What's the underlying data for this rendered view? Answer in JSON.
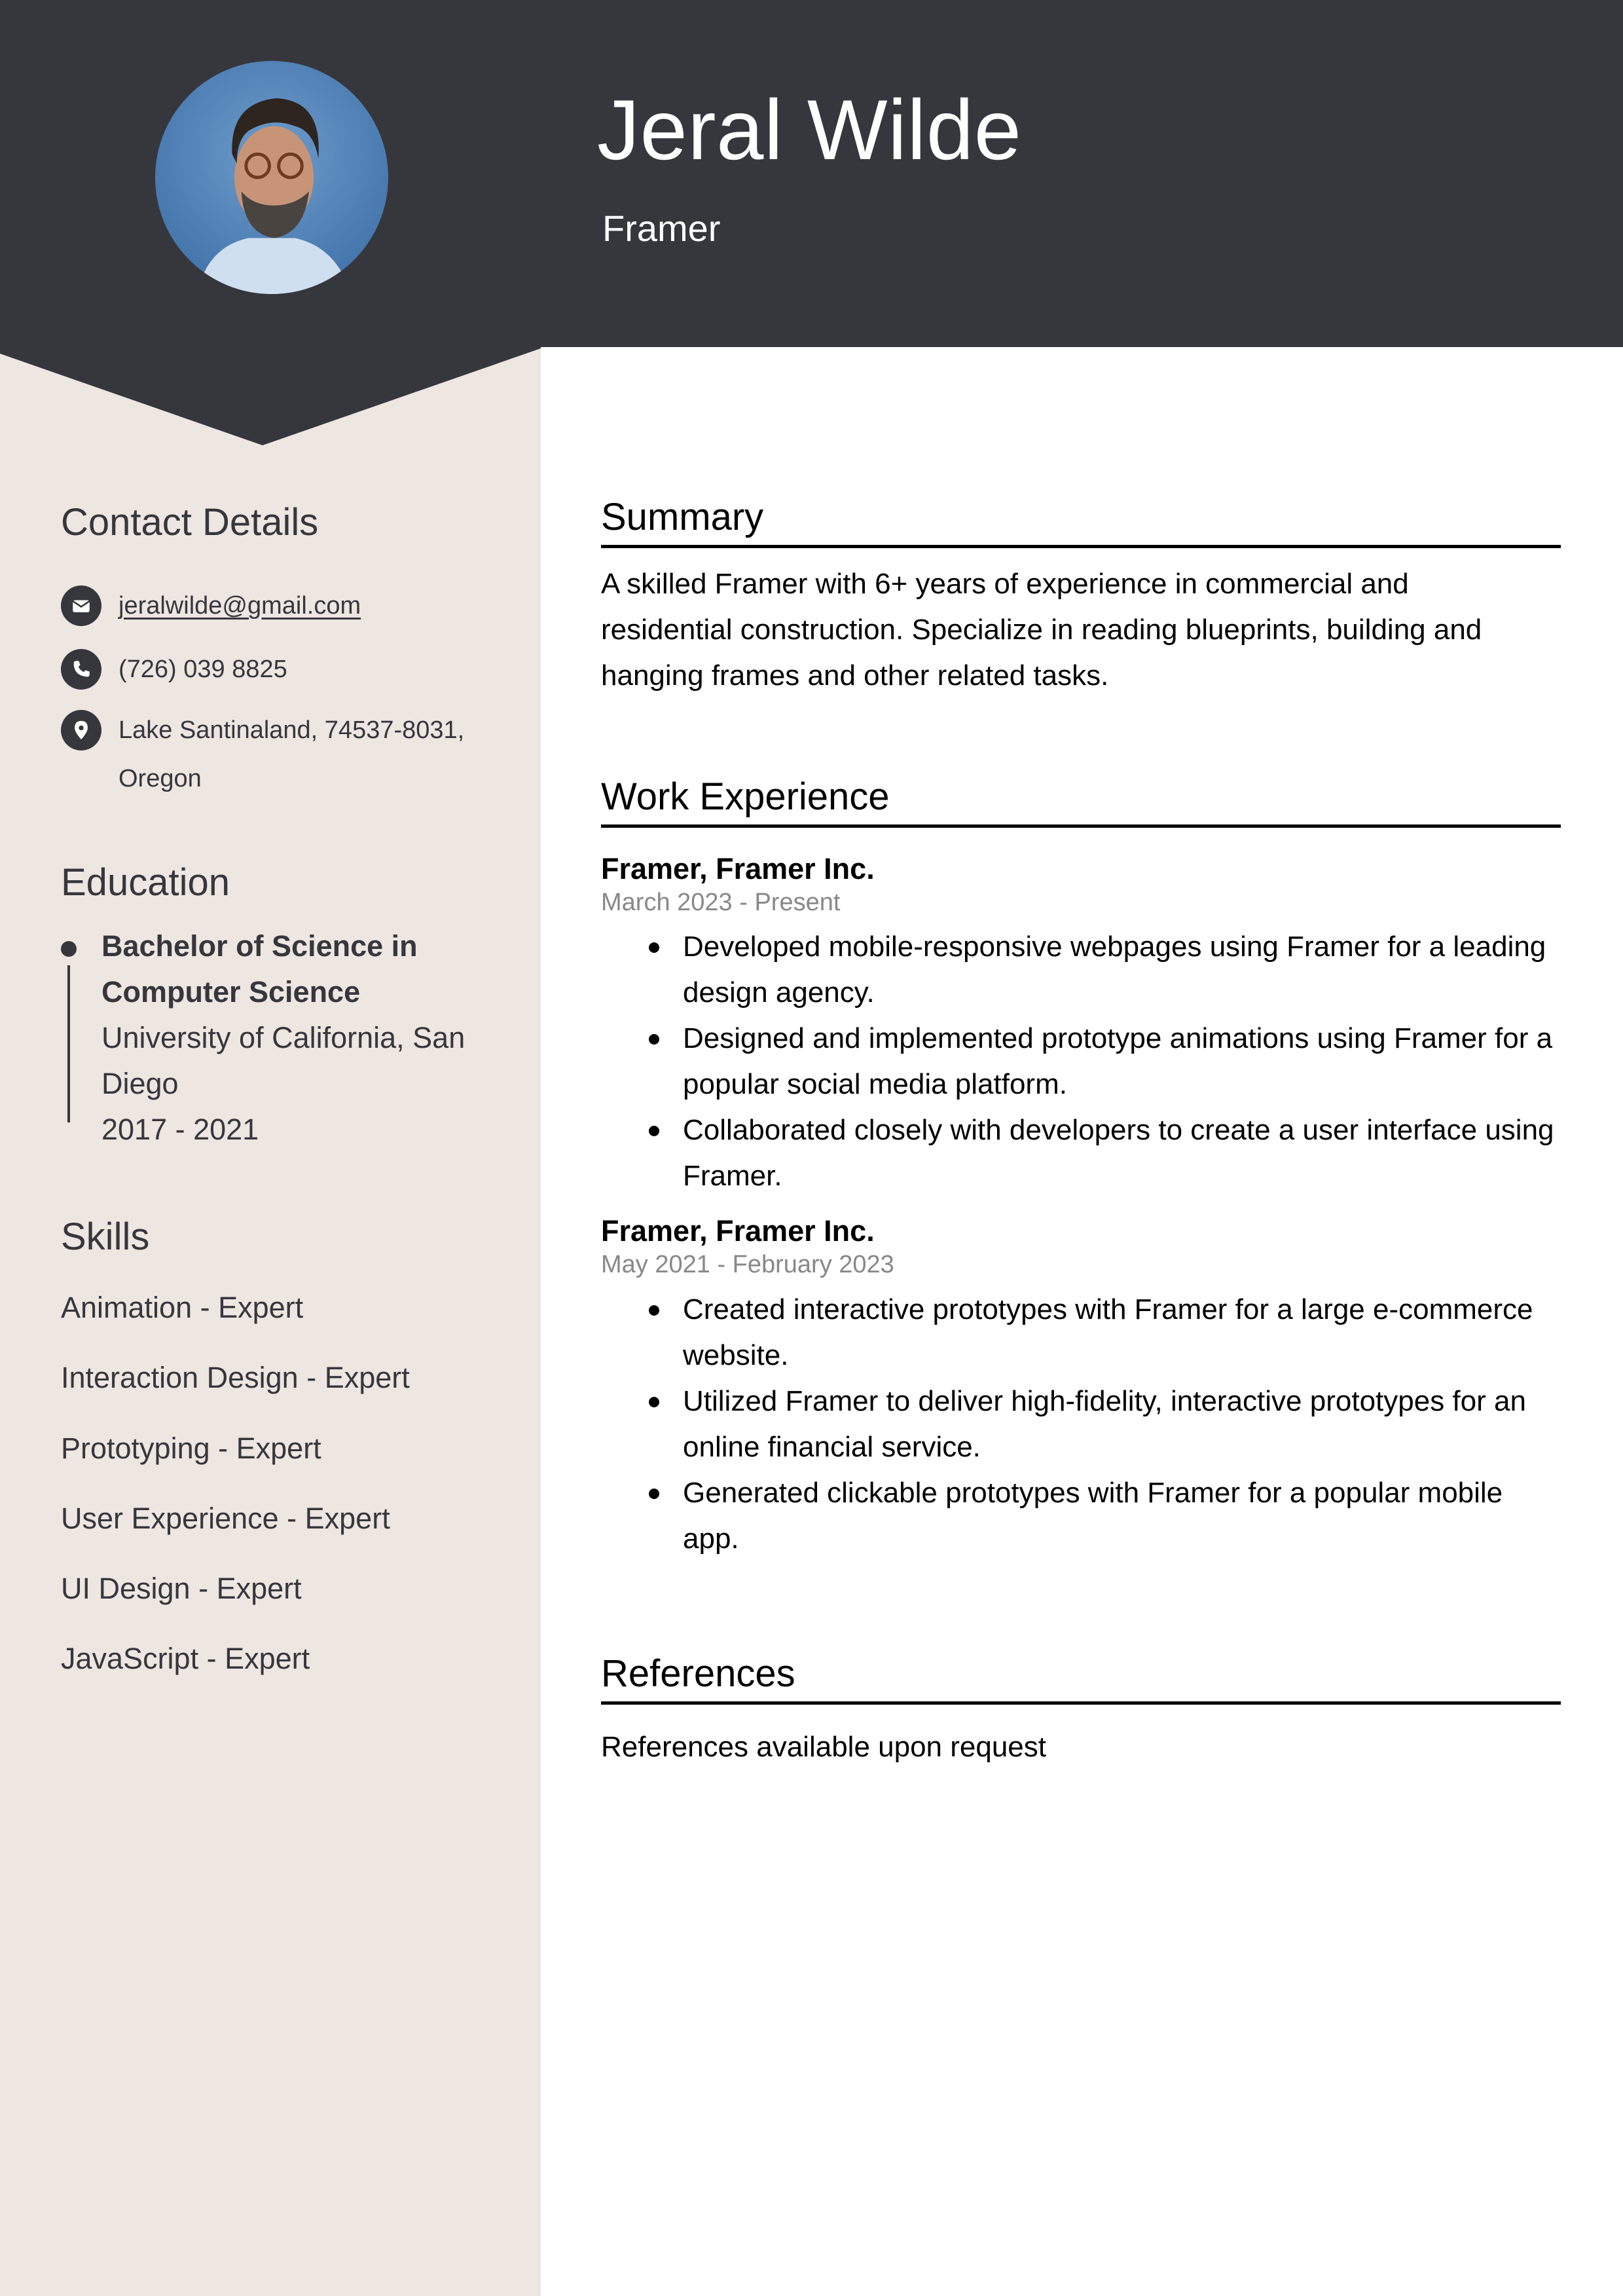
{
  "header": {
    "name": "Jeral Wilde",
    "job_title": "Framer",
    "photo_alt": "portrait-photo"
  },
  "colors": {
    "header_bg": "#36373d",
    "sidebar_bg": "#ede6e1",
    "text_dark": "#36373d",
    "date_gray": "#888888"
  },
  "sidebar": {
    "contact": {
      "heading": "Contact Details",
      "email": "jeralwilde@gmail.com",
      "phone": "(726) 039 8825",
      "address_line1": "Lake Santinaland, 74537-8031,",
      "address_line2": "Oregon",
      "icons": [
        "envelope-icon",
        "phone-icon",
        "map-pin-icon"
      ]
    },
    "education": {
      "heading": "Education",
      "degree_line1": "Bachelor of Science in",
      "degree_line2": "Computer Science",
      "school_line1": "University of California, San",
      "school_line2": "Diego",
      "years": "2017 - 2021"
    },
    "skills": {
      "heading": "Skills",
      "items": [
        "Animation - Expert",
        "Interaction Design - Expert",
        "Prototyping - Expert",
        "User Experience - Expert",
        "UI Design - Expert",
        "JavaScript - Expert"
      ]
    }
  },
  "main": {
    "summary": {
      "heading": "Summary",
      "text": "A skilled Framer with 6+ years of experience in commercial and residential construction. Specialize in reading blueprints, building and hanging frames and other related tasks."
    },
    "experience": {
      "heading": "Work Experience",
      "jobs": [
        {
          "title": "Framer, Framer Inc.",
          "dates": "March 2023 - Present",
          "bullets": [
            "Developed mobile-responsive webpages using Framer for a leading design agency.",
            "Designed and implemented prototype animations using Framer for a popular social media platform.",
            "Collaborated closely with developers to create a user interface using Framer."
          ]
        },
        {
          "title": "Framer, Framer Inc.",
          "dates": "May 2021 - February 2023",
          "bullets": [
            "Created interactive prototypes with Framer for a large e-commerce website.",
            "Utilized Framer to deliver high-fidelity, interactive prototypes for an online financial service.",
            "Generated clickable prototypes with Framer for a popular mobile app."
          ]
        }
      ]
    },
    "references": {
      "heading": "References",
      "text": "References available upon request"
    }
  }
}
